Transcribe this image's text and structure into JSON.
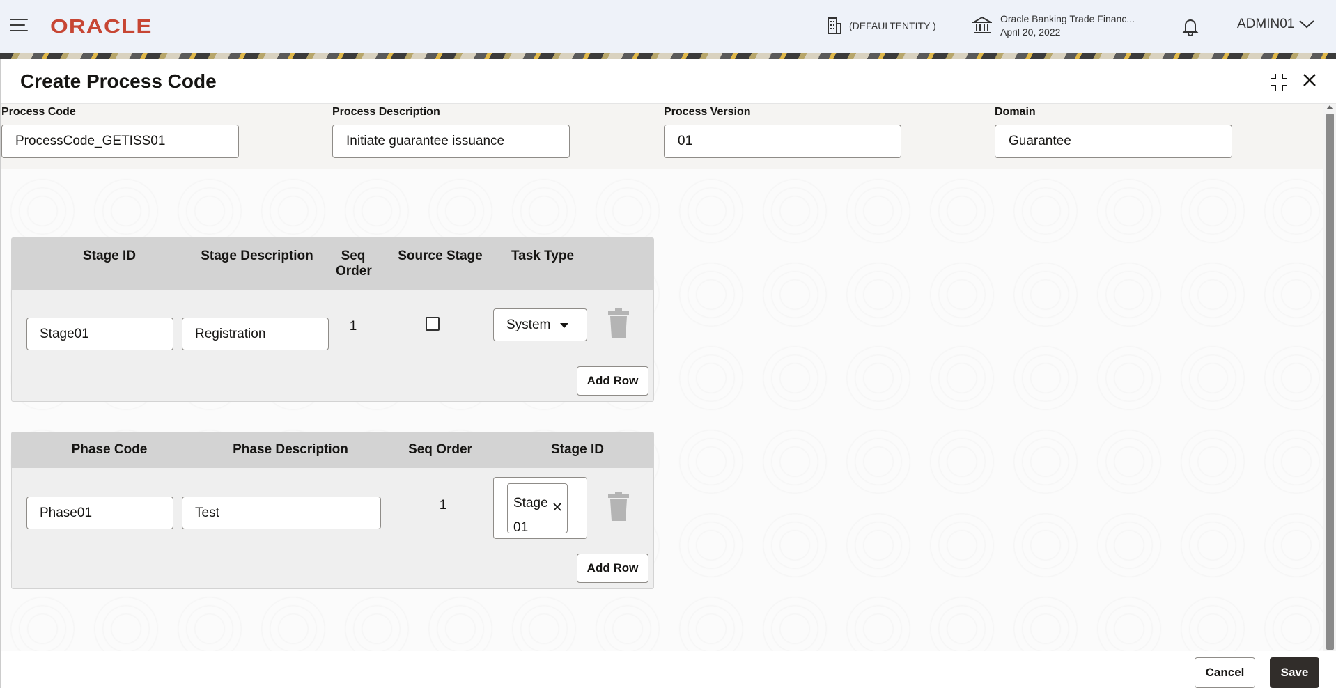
{
  "header": {
    "brand": "ORACLE",
    "entity": "(DEFAULTENTITY )",
    "bank_name": "Oracle Banking Trade Financ...",
    "date": "April 20, 2022",
    "user": "ADMIN01"
  },
  "modal": {
    "title": "Create Process Code",
    "fields": {
      "process_code": {
        "label": "Process Code",
        "value": "ProcessCode_GETISS01"
      },
      "process_description": {
        "label": "Process Description",
        "value": "Initiate guarantee issuance"
      },
      "process_version": {
        "label": "Process Version",
        "value": "01"
      },
      "domain": {
        "label": "Domain",
        "value": "Guarantee"
      }
    },
    "stages": {
      "columns": {
        "stage_id": "Stage ID",
        "stage_description": "Stage Description",
        "seq_order": "Seq Order",
        "source_stage": "Source Stage",
        "task_type": "Task Type"
      },
      "row": {
        "stage_id": "Stage01",
        "stage_description": "Registration",
        "seq_order": "1",
        "source_stage": false,
        "task_type": "System"
      },
      "add_row": "Add Row"
    },
    "phases": {
      "columns": {
        "phase_code": "Phase Code",
        "phase_description": "Phase Description",
        "seq_order": "Seq Order",
        "stage_id": "Stage ID"
      },
      "row": {
        "phase_code": "Phase01",
        "phase_description": "Test",
        "seq_order": "1",
        "stage_chip": "Stage 01"
      },
      "add_row": "Add Row"
    },
    "footer": {
      "cancel": "Cancel",
      "save": "Save"
    }
  }
}
